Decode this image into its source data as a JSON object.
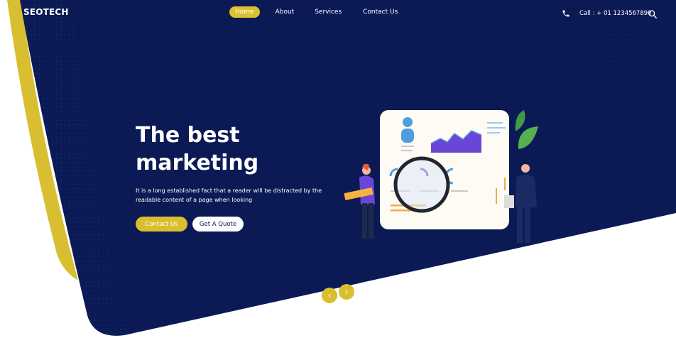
{
  "brand": {
    "logo": "SEOTECH"
  },
  "nav": {
    "items": [
      {
        "label": "Home",
        "active": true
      },
      {
        "label": "About",
        "active": false
      },
      {
        "label": "Services",
        "active": false
      },
      {
        "label": "Contact Us",
        "active": false
      }
    ]
  },
  "header": {
    "call_text": "Call : + 01 1234567890",
    "phone_icon": "phone-icon",
    "search_icon": "search-icon"
  },
  "hero": {
    "title": "The best marketing",
    "description": "It is a long established fact that a reader will be distracted by the readable content of a page when looking",
    "primary_button": "Contact Us",
    "secondary_button": "Get A Quote"
  },
  "carousel": {
    "prev_icon": "chevron-left-icon",
    "next_icon": "chevron-right-icon",
    "prev_glyph": "‹",
    "next_glyph": "›"
  },
  "colors": {
    "navy": "#0b1a55",
    "accent": "#d9be2f",
    "white": "#ffffff"
  }
}
